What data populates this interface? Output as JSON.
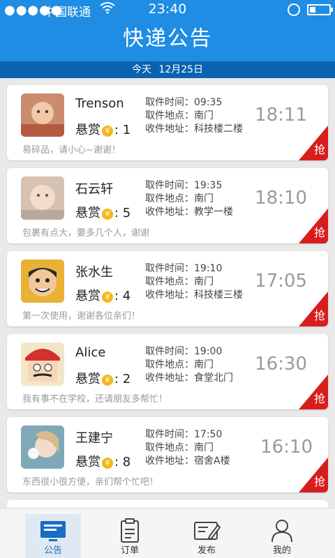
{
  "status": {
    "signal": "●●●●●",
    "carrier": "中国联通",
    "time": "23:40"
  },
  "header": {
    "title": "快递公告"
  },
  "date": {
    "today": "今天",
    "date": "12月25日"
  },
  "labels": {
    "pickup_time": "取件时间：",
    "pickup_location": "取件地点：",
    "delivery_address": "收件地址：",
    "reward": "悬赏",
    "grab": "抢",
    "coin": "¥"
  },
  "orders": [
    {
      "name": "Trenson",
      "reward": ": 1",
      "pickup_time": "09:35",
      "pickup_location": "南门",
      "delivery_address": "科技楼二楼",
      "time": "18:11",
      "note": "易碎品，请小心~谢谢！",
      "avatar_color": "#c98d6e"
    },
    {
      "name": "石云轩",
      "reward": ": 5",
      "pickup_time": "19:35",
      "pickup_location": "南门",
      "delivery_address": "教学一楼",
      "time": "18:10",
      "note": "包裹有点大，要多几个人，谢谢",
      "avatar_color": "#d6c2b3"
    },
    {
      "name": "张水生",
      "reward": ": 4",
      "pickup_time": "19:10",
      "pickup_location": "南门",
      "delivery_address": "科技楼三楼",
      "time": "17:05",
      "note": "第一次使用，谢谢各位亲们！",
      "avatar_color": "#e7b236"
    },
    {
      "name": "Alice",
      "reward": ": 2",
      "pickup_time": "19:00",
      "pickup_location": "南门",
      "delivery_address": "食堂北门",
      "time": "16:30",
      "note": "我有事不在学校，还请朋友多帮忙！",
      "avatar_color": "#d3312d"
    },
    {
      "name": "王建宁",
      "reward": ": 8",
      "pickup_time": "17:50",
      "pickup_location": "南门",
      "delivery_address": "宿舍A楼",
      "time": "16:10",
      "note": "东西很小很方便，亲们帮个忙吧！",
      "avatar_color": "#7fa9b8"
    }
  ],
  "tabs": [
    {
      "label": "公告",
      "icon": "notice-icon",
      "active": true
    },
    {
      "label": "订单",
      "icon": "orders-icon",
      "active": false
    },
    {
      "label": "发布",
      "icon": "publish-icon",
      "active": false
    },
    {
      "label": "我的",
      "icon": "profile-icon",
      "active": false
    }
  ],
  "colors": {
    "primary": "#1e8de3",
    "date_bar": "#0a62b0",
    "grab": "#d81d1d",
    "coin": "#f3b71c"
  }
}
